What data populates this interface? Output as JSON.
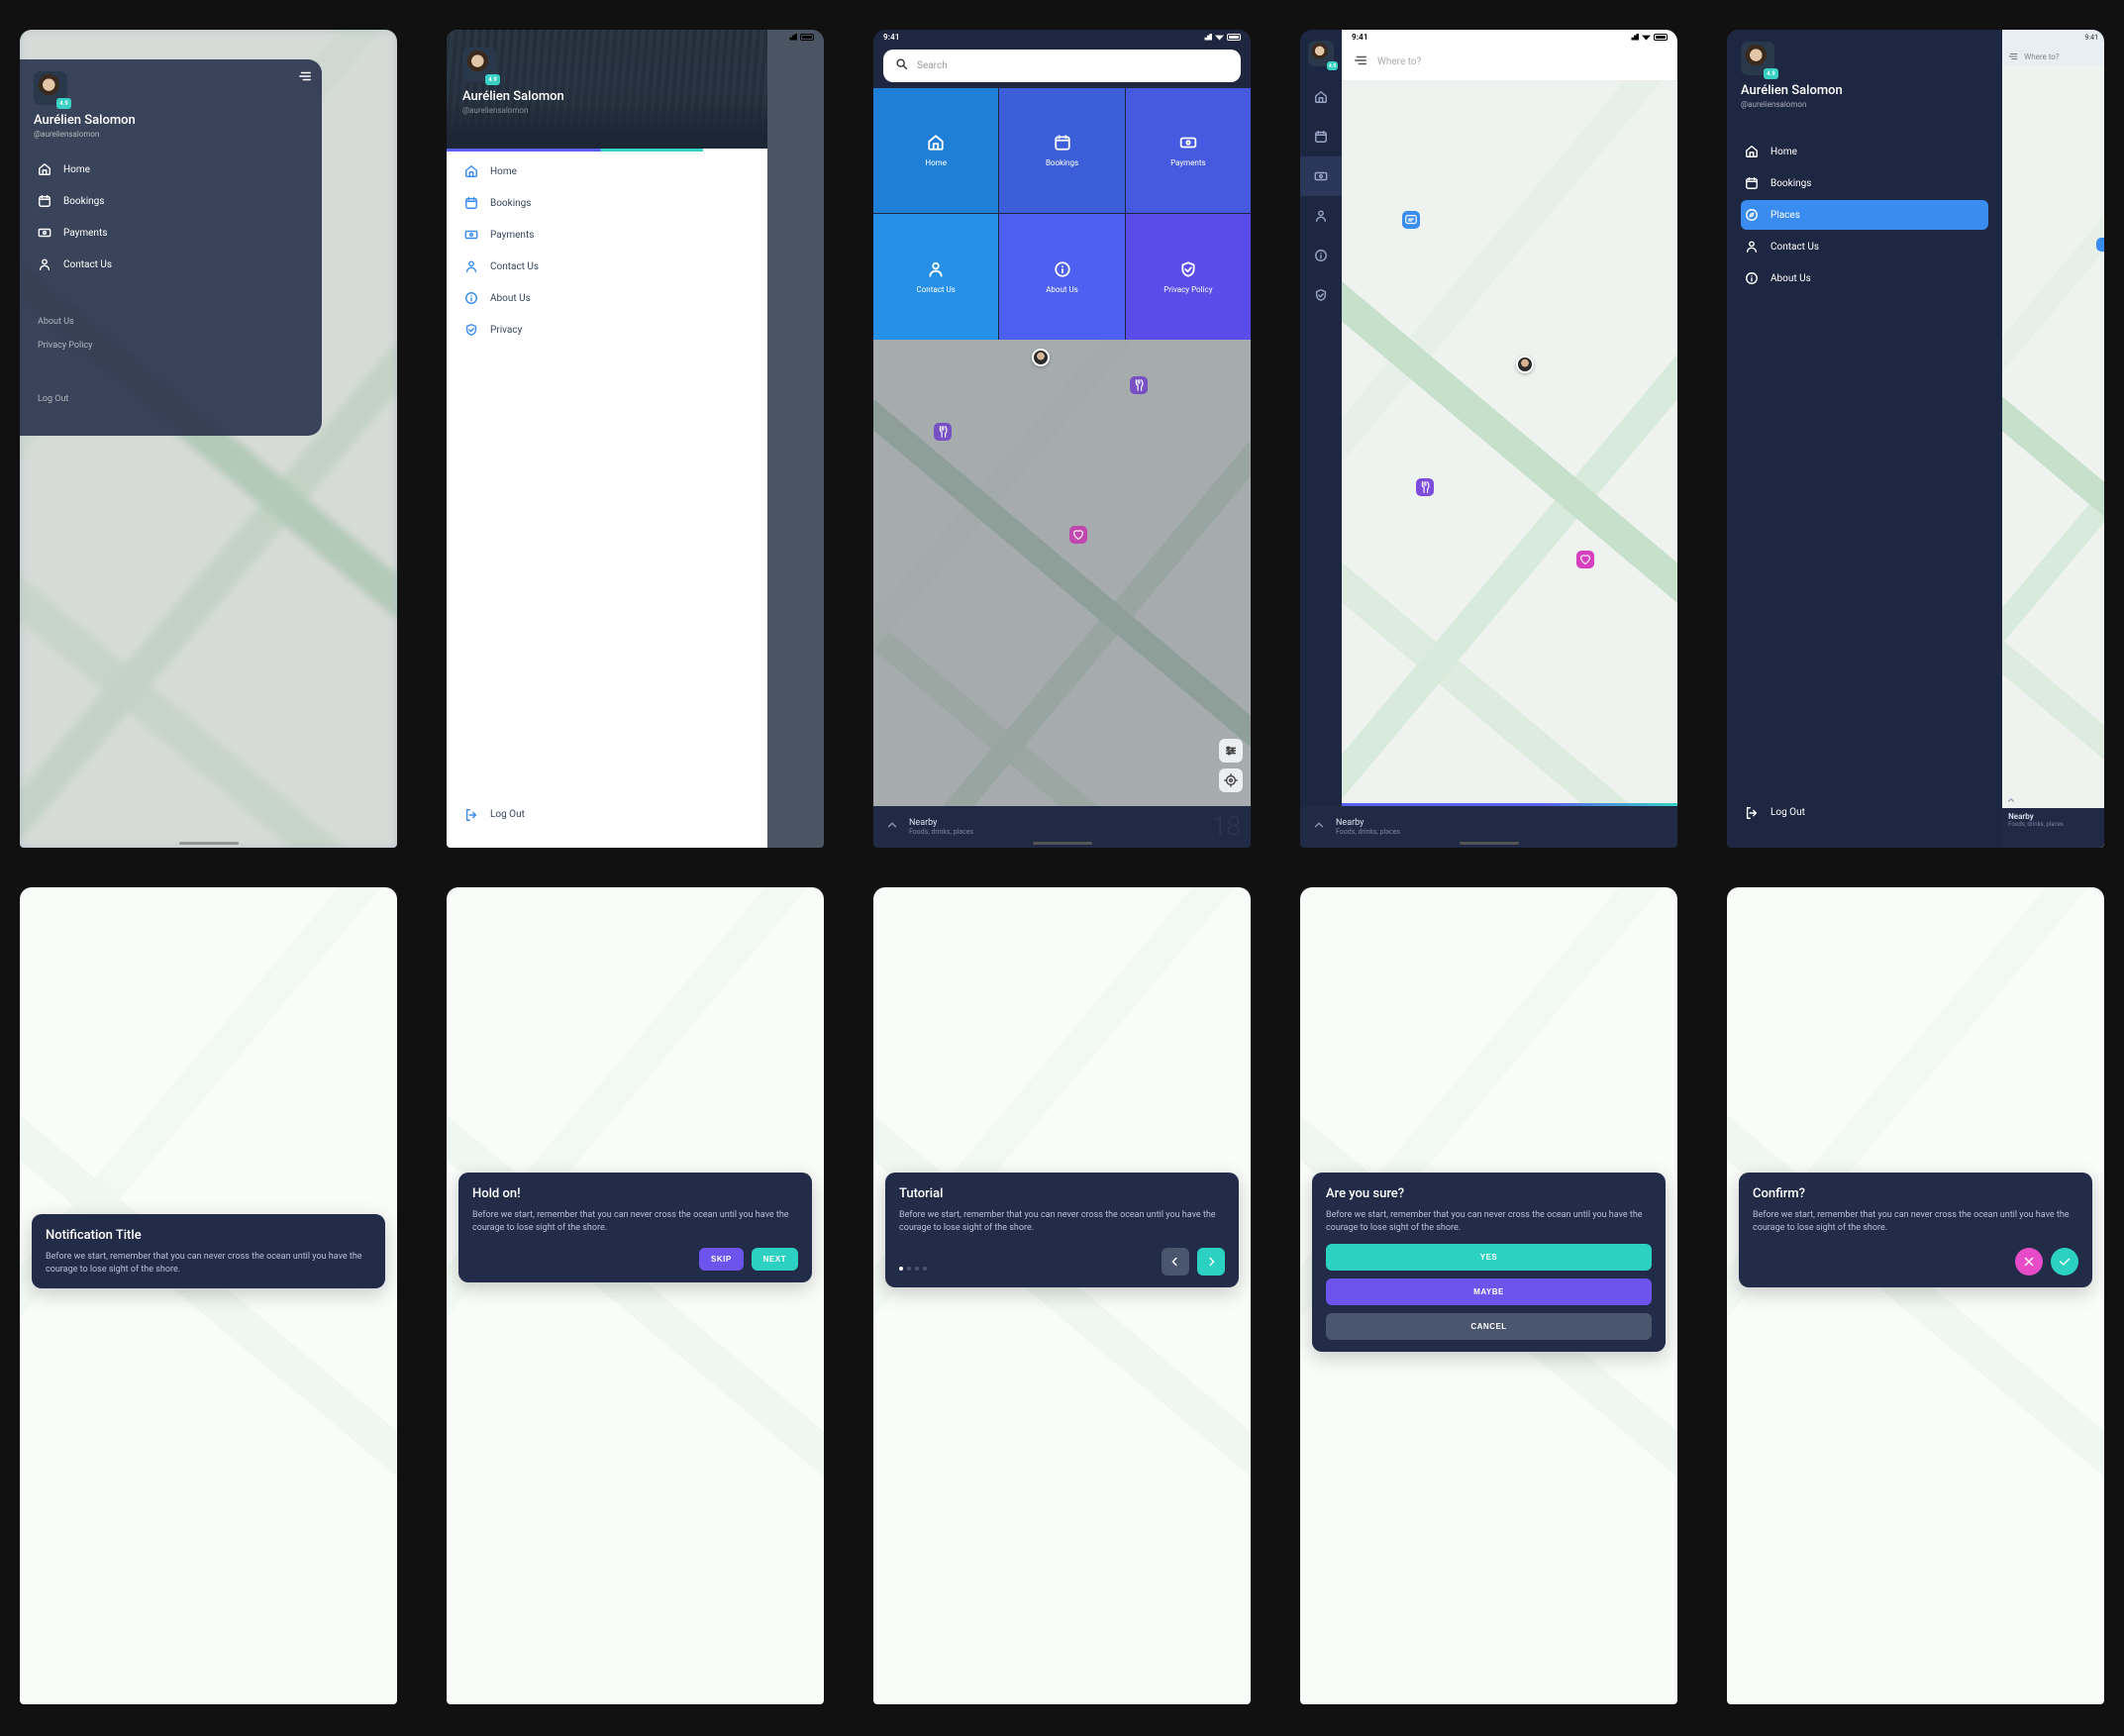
{
  "user": {
    "name": "Aurélien Salomon",
    "handle": "@aureliensalomon",
    "rating": "4.9"
  },
  "time": "9:41",
  "nav": {
    "home": "Home",
    "bookings": "Bookings",
    "payments": "Payments",
    "contact": "Contact Us",
    "about": "About Us",
    "privacy_short": "Privacy",
    "privacy_policy": "Privacy Policy",
    "places": "Places",
    "logout": "Log Out"
  },
  "search": {
    "placeholder": "Search"
  },
  "where": {
    "placeholder": "Where to?"
  },
  "footer": {
    "title": "Nearby",
    "subtitle": "Foods, drinks, places",
    "count": "18"
  },
  "cards": {
    "notification": {
      "title": "Notification Title",
      "body": "Before we start, remember that you can never cross the ocean until you have the courage to lose sight of the shore."
    },
    "hold": {
      "title": "Hold on!",
      "body": "Before we start, remember that you can never cross the ocean until you have the courage to lose sight of the shore.",
      "skip": "SKIP",
      "next": "NEXT"
    },
    "tutorial": {
      "title": "Tutorial",
      "body": "Before we start, remember that you can never cross the ocean until you have the courage to lose sight of the shore."
    },
    "sure": {
      "title": "Are you sure?",
      "body": "Before we start, remember that you can never cross the ocean until you have the courage to lose sight of the shore.",
      "yes": "YES",
      "maybe": "MAYBE",
      "cancel": "CANCEL"
    },
    "confirm": {
      "title": "Confirm?",
      "body": "Before we start, remember that you can never cross the ocean until you have the courage to lose sight of the shore."
    }
  }
}
